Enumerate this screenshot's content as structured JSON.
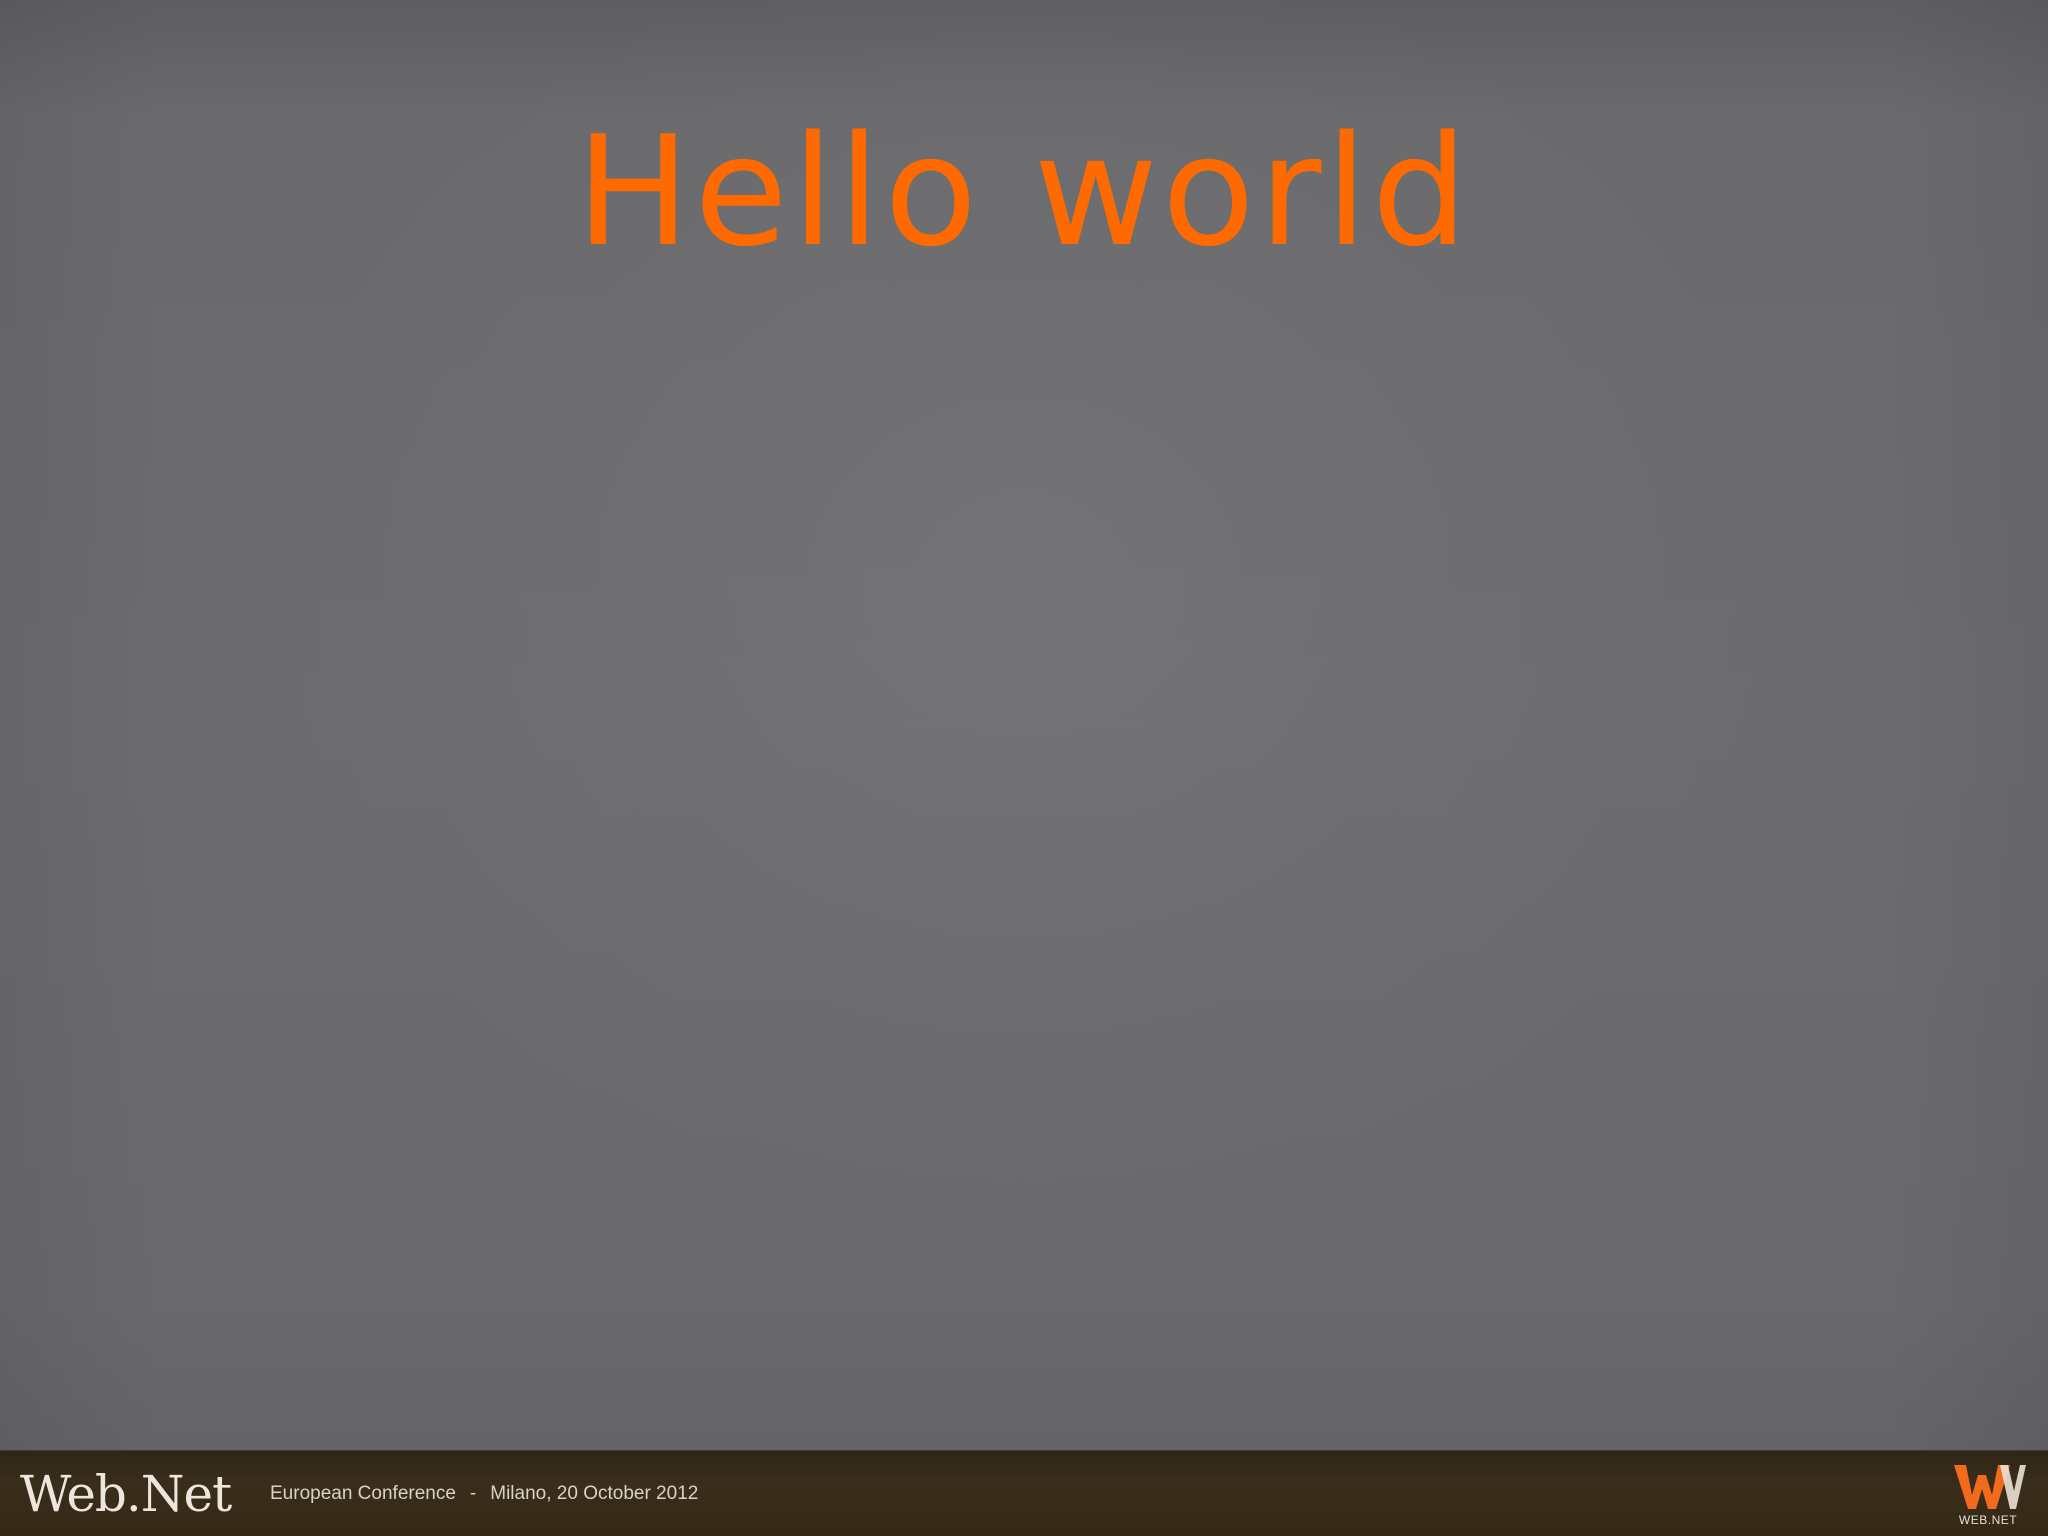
{
  "slide": {
    "title": "Hello world"
  },
  "footer": {
    "logo_text": "Web.Net",
    "conference": "European Conference",
    "separator": "-",
    "location_date": "Milano, 20 October 2012",
    "brand_mark_label": "WEB.NET"
  },
  "colors": {
    "title": "#ff6a00",
    "background": "#6b6b6e",
    "footer": "#3a2d1b",
    "brand_mark": "#f26a1b"
  }
}
